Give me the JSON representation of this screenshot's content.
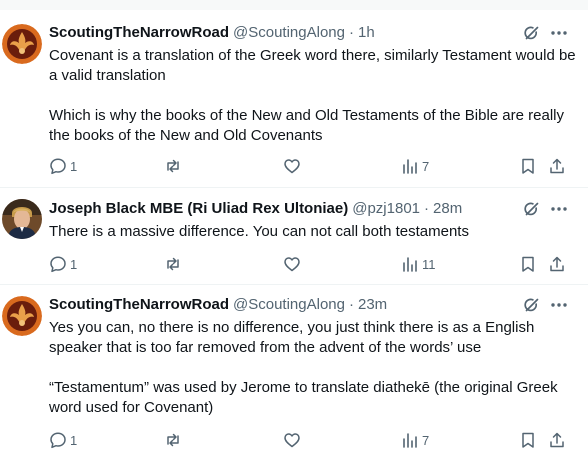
{
  "colors": {
    "text_primary": "#0f1419",
    "text_secondary": "#536471",
    "divider": "#eff3f4",
    "background": "#ffffff"
  },
  "tweets": [
    {
      "author": {
        "name": "ScoutingTheNarrowRoad",
        "handle": "@ScoutingAlong",
        "time": "1h",
        "separator": "·",
        "avatar": "scouting-logo-avatar"
      },
      "paragraphs": [
        "Covenant is a translation of the Greek word there, similarly Testament would be a valid translation",
        "Which is why the books of the New and Old Testaments of the Bible are really the books of the New and Old Covenants"
      ],
      "actions": {
        "replies": "1",
        "reposts": "",
        "likes": "",
        "views": "7"
      }
    },
    {
      "author": {
        "name": "Joseph Black MBE (Ri Uliad Rex Ultoniae)",
        "handle": "@pzj1801",
        "time": "28m",
        "separator": "·",
        "avatar": "person-portrait-avatar"
      },
      "paragraphs": [
        "There is a massive difference. You can not call both testaments"
      ],
      "actions": {
        "replies": "1",
        "reposts": "",
        "likes": "",
        "views": "11"
      }
    },
    {
      "author": {
        "name": "ScoutingTheNarrowRoad",
        "handle": "@ScoutingAlong",
        "time": "23m",
        "separator": "·",
        "avatar": "scouting-logo-avatar"
      },
      "paragraphs": [
        "Yes you can, no there is no difference, you just think there is as a English speaker that is too far removed from the advent of the words’ use",
        "“Testamentum” was used by Jerome to translate diathekē (the original Greek word used for Covenant)"
      ],
      "actions": {
        "replies": "1",
        "reposts": "",
        "likes": "",
        "views": "7"
      }
    }
  ],
  "icons": {
    "reply": "reply-icon",
    "repost": "repost-icon",
    "like": "heart-icon",
    "views": "views-chart-icon",
    "bookmark": "bookmark-icon",
    "share": "share-icon",
    "grok": "grok-icon",
    "more": "more-dots-icon"
  }
}
